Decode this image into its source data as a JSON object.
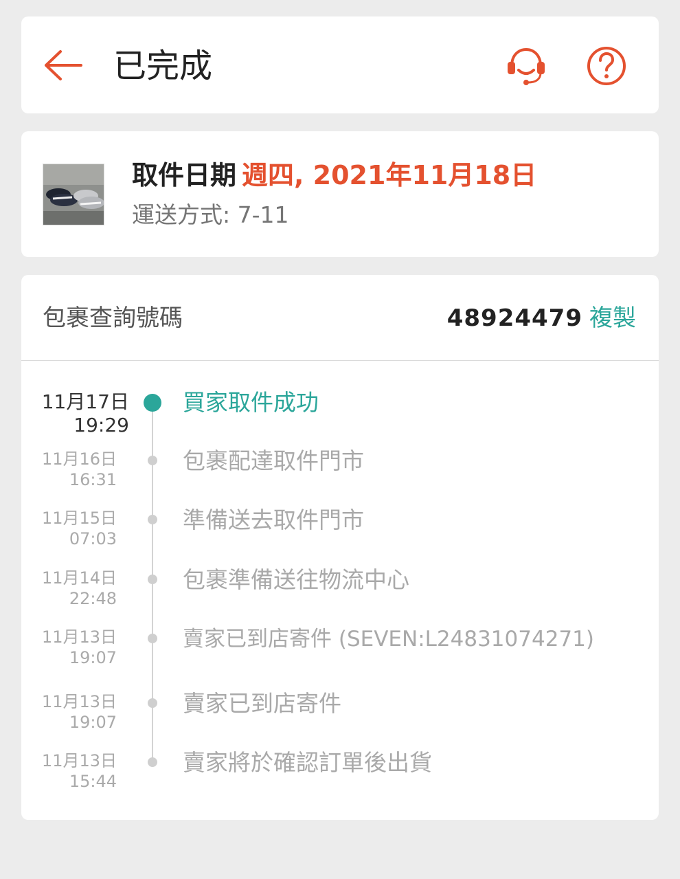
{
  "header": {
    "title": "已完成",
    "back_icon": "arrow-left-icon",
    "support_icon": "headset-icon",
    "help_icon": "question-circle-icon",
    "accent_color": "#e4512f"
  },
  "pickup": {
    "label": "取件日期",
    "date": "週四, 2021年11月18日",
    "shipping": "運送方式: 7-11"
  },
  "tracking": {
    "label": "包裹查詢號碼",
    "number": "48924479",
    "copy_label": "複製",
    "copy_color": "#2ba69a",
    "events": [
      {
        "date": "11月17日",
        "time": "19:29",
        "text": "買家取件成功",
        "active": true
      },
      {
        "date": "11月16日",
        "time": "16:31",
        "text": "包裹配達取件門市",
        "active": false
      },
      {
        "date": "11月15日",
        "time": "07:03",
        "text": "準備送去取件門市",
        "active": false
      },
      {
        "date": "11月14日",
        "time": "22:48",
        "text": "包裹準備送往物流中心",
        "active": false
      },
      {
        "date": "11月13日",
        "time": "19:07",
        "text": "賣家已到店寄件 (SEVEN:L24831074271)",
        "active": false
      },
      {
        "date": "11月13日",
        "time": "19:07",
        "text": "賣家已到店寄件",
        "active": false
      },
      {
        "date": "11月13日",
        "time": "15:44",
        "text": "賣家將於確認訂單後出貨",
        "active": false
      }
    ]
  }
}
